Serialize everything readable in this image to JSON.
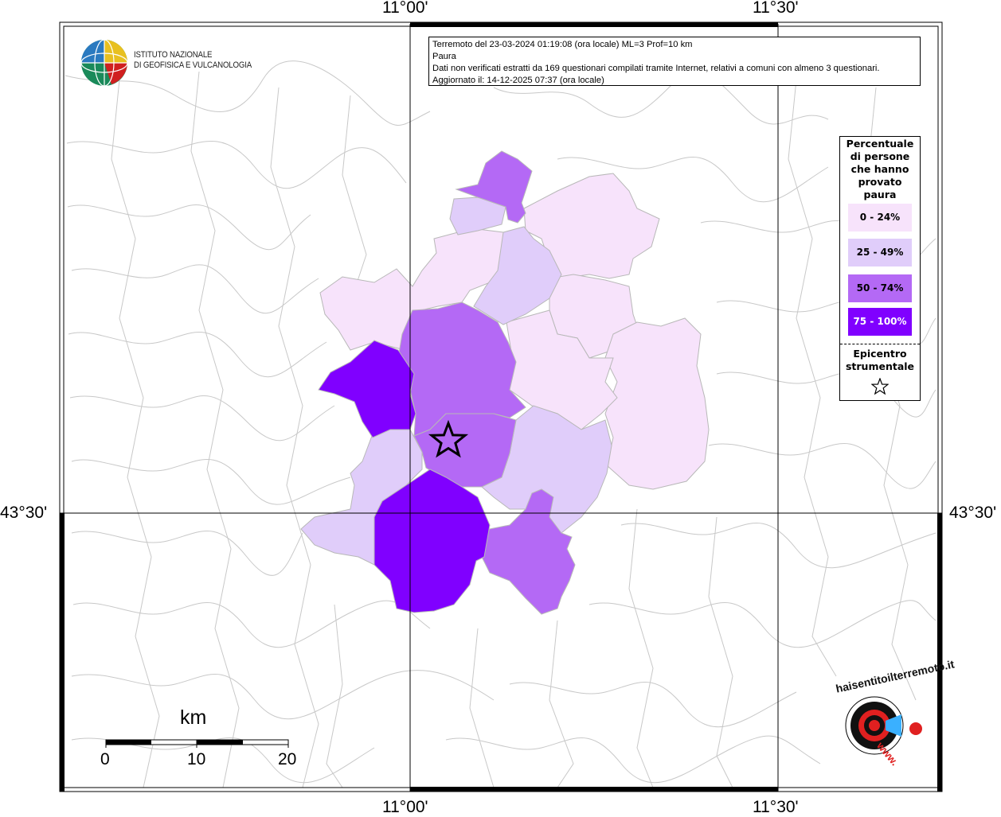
{
  "info": {
    "line1": "Terremoto del 23-03-2024 01:19:08 (ora locale) ML=3 Prof=10 km",
    "line2": "Paura",
    "line3": "Dati non verificati estratti da 169 questionari compilati tramite Internet, relativi a comuni con almeno 3 questionari.",
    "line4": "Aggiornato il: 14-12-2025 07:37 (ora locale)"
  },
  "coords": {
    "lon_left": "11°00'",
    "lon_right": "11°30'",
    "lat": "43°30'"
  },
  "logo": {
    "line1": "ISTITUTO NAZIONALE",
    "line2": "DI GEOFISICA E VULCANOLOGIA"
  },
  "legend": {
    "title": [
      "Percentuale",
      "di persone",
      "che hanno",
      "provato",
      "paura"
    ],
    "items": [
      {
        "label": "0 - 24%",
        "color": "#f7e3fb"
      },
      {
        "label": "25 - 49%",
        "color": "#e0cdfa"
      },
      {
        "label": "50 - 74%",
        "color": "#b469f5"
      },
      {
        "label": "75 - 100%",
        "color": "#8000ff"
      }
    ],
    "epicenter_title": [
      "Epicentro",
      "strumentale"
    ]
  },
  "scale": {
    "unit": "km",
    "ticks": [
      "0",
      "10",
      "20"
    ]
  },
  "watermark": {
    "text": "haisentitoilterremoto.it",
    "www": "www."
  }
}
